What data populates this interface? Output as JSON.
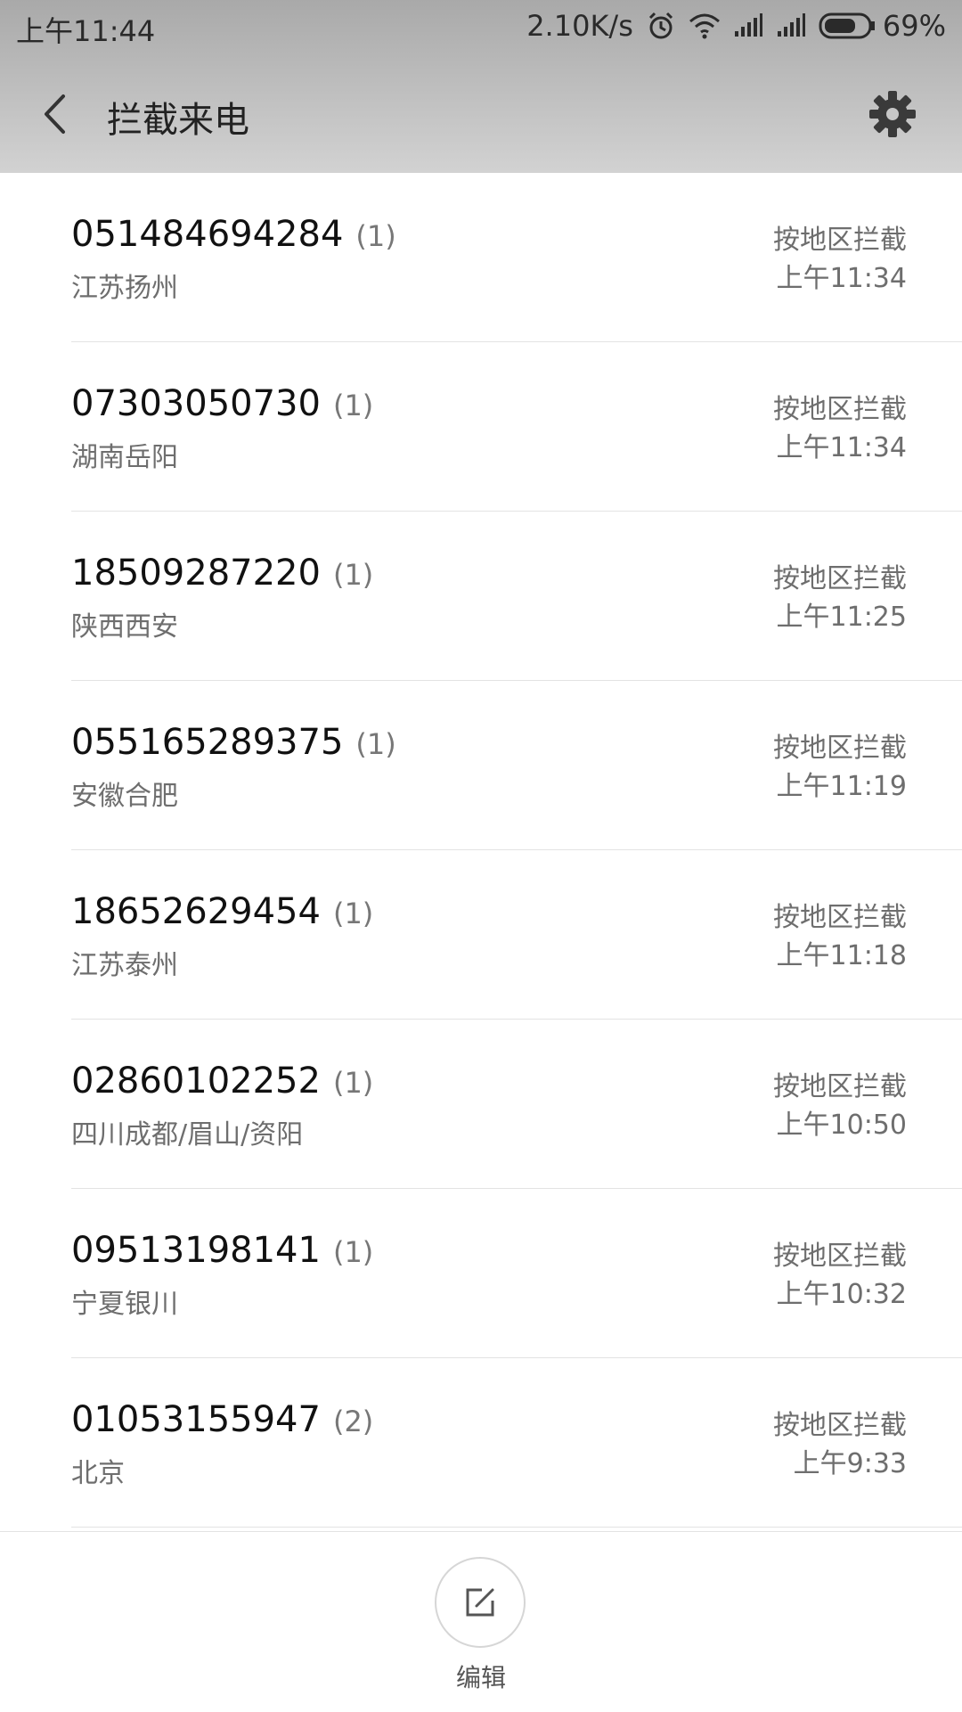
{
  "status_bar": {
    "time": "上午11:44",
    "network_speed": "2.10K/s",
    "battery": "69%",
    "icons": [
      "alarm-icon",
      "wifi-icon",
      "signal-icon",
      "signal-icon",
      "battery-icon"
    ]
  },
  "header": {
    "title": "拦截来电",
    "back_icon": "back-chevron-icon",
    "settings_icon": "gear-icon"
  },
  "calls": [
    {
      "number": "051484694284",
      "count": "(1)",
      "location": "江苏扬州",
      "reason": "按地区拦截",
      "time": "上午11:34"
    },
    {
      "number": "07303050730",
      "count": "(1)",
      "location": "湖南岳阳",
      "reason": "按地区拦截",
      "time": "上午11:34"
    },
    {
      "number": "18509287220",
      "count": "(1)",
      "location": "陕西西安",
      "reason": "按地区拦截",
      "time": "上午11:25"
    },
    {
      "number": "055165289375",
      "count": "(1)",
      "location": "安徽合肥",
      "reason": "按地区拦截",
      "time": "上午11:19"
    },
    {
      "number": "18652629454",
      "count": "(1)",
      "location": "江苏泰州",
      "reason": "按地区拦截",
      "time": "上午11:18"
    },
    {
      "number": "02860102252",
      "count": "(1)",
      "location": "四川成都/眉山/资阳",
      "reason": "按地区拦截",
      "time": "上午10:50"
    },
    {
      "number": "09513198141",
      "count": "(1)",
      "location": "宁夏银川",
      "reason": "按地区拦截",
      "time": "上午10:32"
    },
    {
      "number": "01053155947",
      "count": "(2)",
      "location": "北京",
      "reason": "按地区拦截",
      "time": "上午9:33"
    }
  ],
  "bottom": {
    "edit_label": "编辑",
    "edit_icon": "edit-icon"
  }
}
